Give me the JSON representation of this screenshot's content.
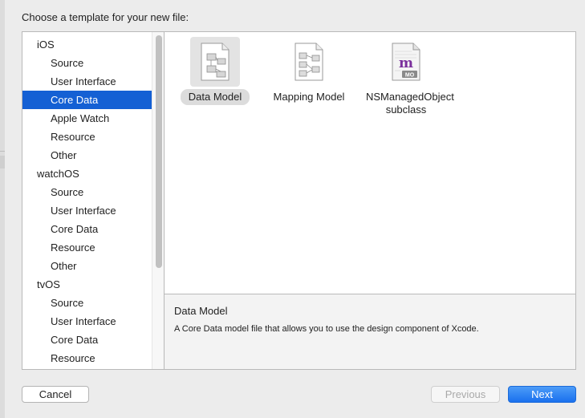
{
  "dialog": {
    "heading": "Choose a template for your new file:"
  },
  "sidebar": {
    "items": [
      {
        "label": "iOS",
        "kind": "group"
      },
      {
        "label": "Source",
        "kind": "item"
      },
      {
        "label": "User Interface",
        "kind": "item"
      },
      {
        "label": "Core Data",
        "kind": "item",
        "selected": true
      },
      {
        "label": "Apple Watch",
        "kind": "item"
      },
      {
        "label": "Resource",
        "kind": "item"
      },
      {
        "label": "Other",
        "kind": "item"
      },
      {
        "label": "watchOS",
        "kind": "group"
      },
      {
        "label": "Source",
        "kind": "item"
      },
      {
        "label": "User Interface",
        "kind": "item"
      },
      {
        "label": "Core Data",
        "kind": "item"
      },
      {
        "label": "Resource",
        "kind": "item"
      },
      {
        "label": "Other",
        "kind": "item"
      },
      {
        "label": "tvOS",
        "kind": "group"
      },
      {
        "label": "Source",
        "kind": "item"
      },
      {
        "label": "User Interface",
        "kind": "item"
      },
      {
        "label": "Core Data",
        "kind": "item"
      },
      {
        "label": "Resource",
        "kind": "item"
      }
    ]
  },
  "templates": [
    {
      "label": "Data Model",
      "icon": "data-model-icon",
      "selected": true
    },
    {
      "label": "Mapping Model",
      "icon": "mapping-model-icon"
    },
    {
      "label": "NSManagedObject subclass",
      "icon": "managed-object-icon",
      "badge_letter": "m",
      "badge_text": "MO"
    }
  ],
  "detail": {
    "title": "Data Model",
    "description": "A Core Data model file that allows you to use the design component of Xcode."
  },
  "buttons": {
    "cancel": "Cancel",
    "previous": "Previous",
    "next": "Next"
  },
  "colors": {
    "selection": "#1460d4",
    "primary_button": "#1a70ee",
    "badge_letter": "#7a2f9c"
  }
}
